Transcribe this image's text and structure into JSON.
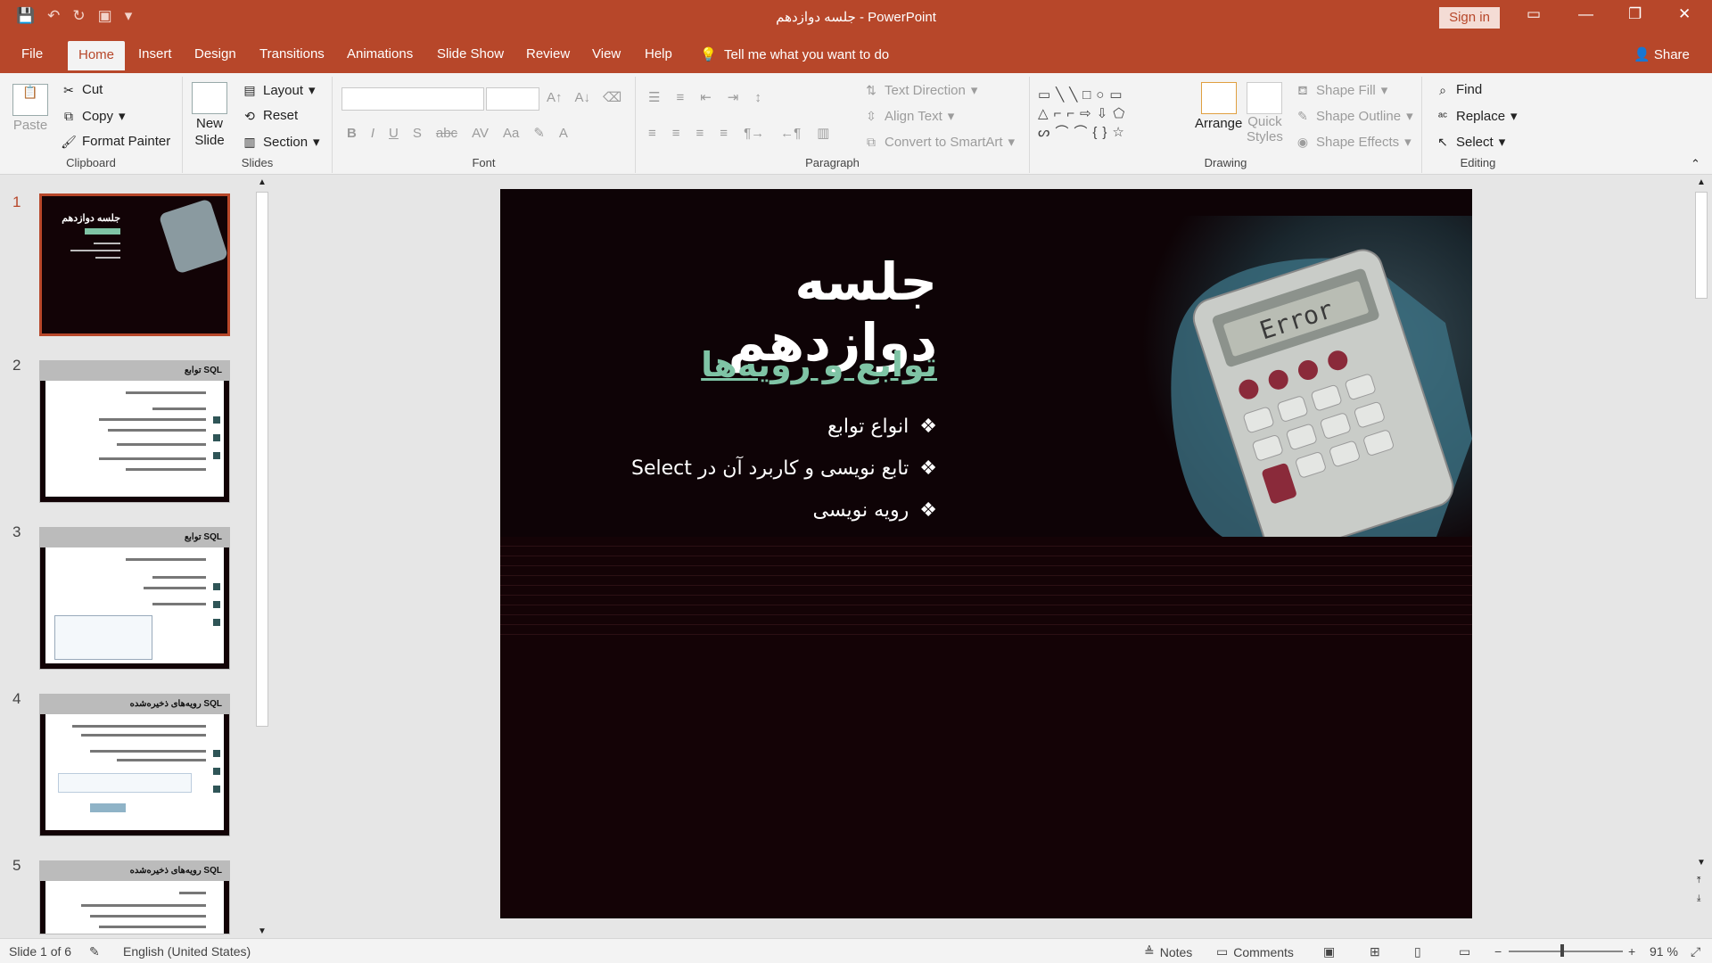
{
  "window": {
    "title": "جلسه دوازدهم  -  PowerPoint",
    "signin": "Sign in",
    "accent": "#b7472a"
  },
  "tabs": [
    "File",
    "Home",
    "Insert",
    "Design",
    "Transitions",
    "Animations",
    "Slide Show",
    "Review",
    "View",
    "Help"
  ],
  "tellme": "Tell me what you want to do",
  "share": "Share",
  "ribbon": {
    "clipboard": {
      "label": "Clipboard",
      "paste": "Paste",
      "cut": "Cut",
      "copy": "Copy",
      "format_painter": "Format Painter"
    },
    "slides": {
      "label": "Slides",
      "new_slide_1": "New",
      "new_slide_2": "Slide",
      "layout": "Layout",
      "reset": "Reset",
      "section": "Section"
    },
    "font": {
      "label": "Font"
    },
    "paragraph": {
      "label": "Paragraph",
      "text_direction": "Text Direction",
      "align_text": "Align Text",
      "convert_smartart": "Convert to SmartArt"
    },
    "drawing": {
      "label": "Drawing",
      "arrange": "Arrange",
      "quick_styles_1": "Quick",
      "quick_styles_2": "Styles",
      "shape_fill": "Shape Fill",
      "shape_outline": "Shape Outline",
      "shape_effects": "Shape Effects"
    },
    "editing": {
      "label": "Editing",
      "find": "Find",
      "replace": "Replace",
      "select": "Select"
    }
  },
  "thumbnails": [
    {
      "num": "1",
      "title": "جلسه دوازدهم"
    },
    {
      "num": "2",
      "title": "توابع SQL"
    },
    {
      "num": "3",
      "title": "توابع SQL"
    },
    {
      "num": "4",
      "title": "رویه‌های ذخیره‌شده SQL"
    },
    {
      "num": "5",
      "title": "رویه‌های ذخیره‌شده SQL"
    }
  ],
  "slide": {
    "title": "جلسه دوازدهم",
    "subtitle": "توابع و رویه‌ها",
    "bullets": [
      "انواع توابع",
      "تابع نویسی و کاربرد آن در Select",
      "رویه نویسی"
    ],
    "calc_display": "Error"
  },
  "status": {
    "slide_info": "Slide 1 of 6",
    "language": "English (United States)",
    "notes": "Notes",
    "comments": "Comments",
    "zoom": "91 %"
  }
}
